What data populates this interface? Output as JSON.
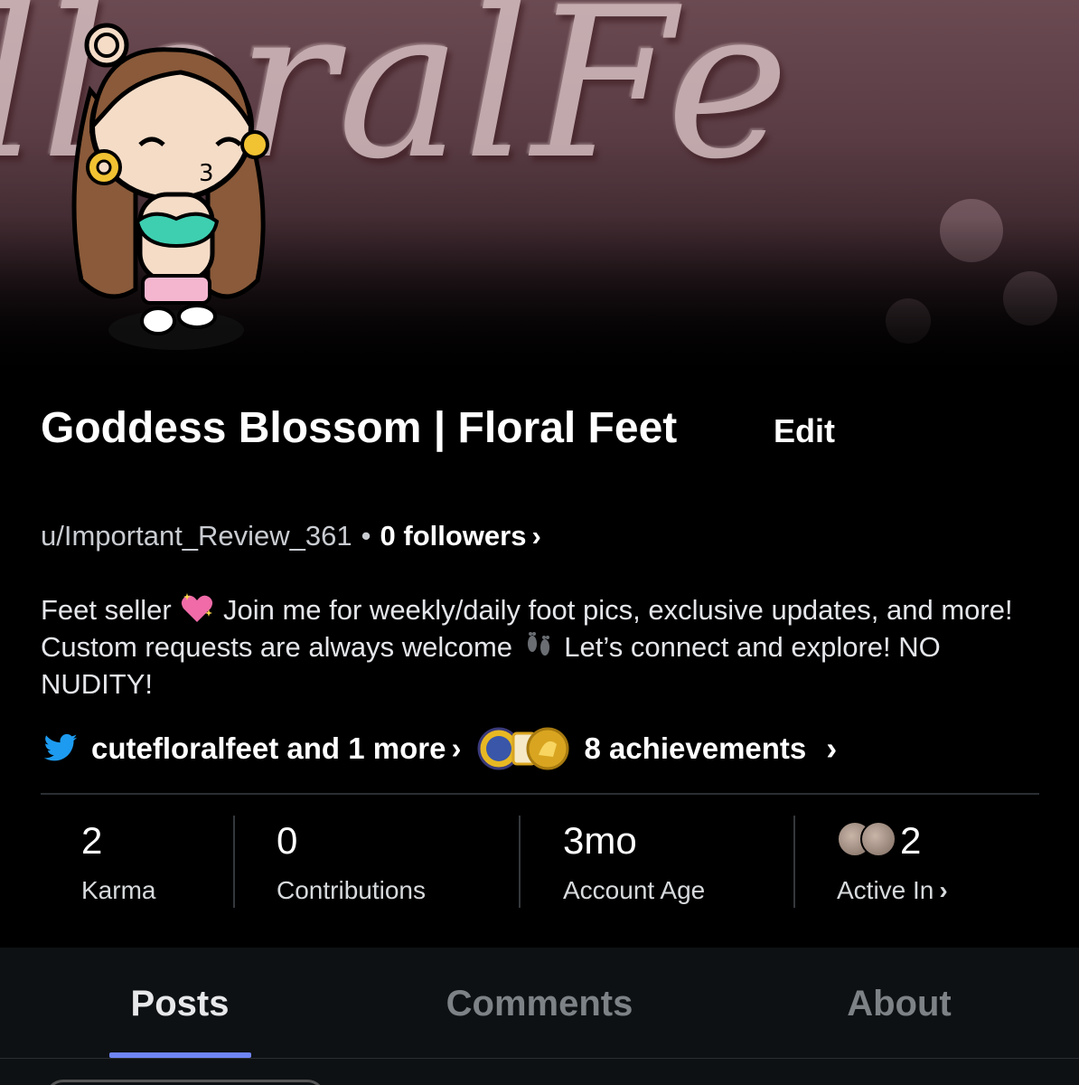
{
  "banner": {
    "text": "lloralFe"
  },
  "profile": {
    "display_name": "Goddess Blossom | Floral Feet",
    "edit_label": "Edit",
    "username": "u/Important_Review_361",
    "separator": "•",
    "followers": "0 followers",
    "bio_part1": "Feet seller",
    "bio_part2": "Join me for weekly/daily foot pics, exclusive updates, and more! Custom requests are always welcome",
    "bio_part3": "Let’s connect and explore! NO NUDITY!"
  },
  "social": {
    "icon": "twitter-icon",
    "link_text": "cutefloralfeet and 1 more",
    "achievements_text": "8 achievements"
  },
  "stats": [
    {
      "value": "2",
      "label": "Karma"
    },
    {
      "value": "0",
      "label": "Contributions"
    },
    {
      "value": "3mo",
      "label": "Account Age"
    },
    {
      "value": "2",
      "label": "Active In"
    }
  ],
  "tabs": [
    {
      "label": "Posts",
      "active": true
    },
    {
      "label": "Comments",
      "active": false
    },
    {
      "label": "About",
      "active": false
    }
  ],
  "colors": {
    "accent": "#6f85f5",
    "twitter": "#1d9bf0",
    "background": "#000000",
    "tabbar": "#0e1113"
  }
}
